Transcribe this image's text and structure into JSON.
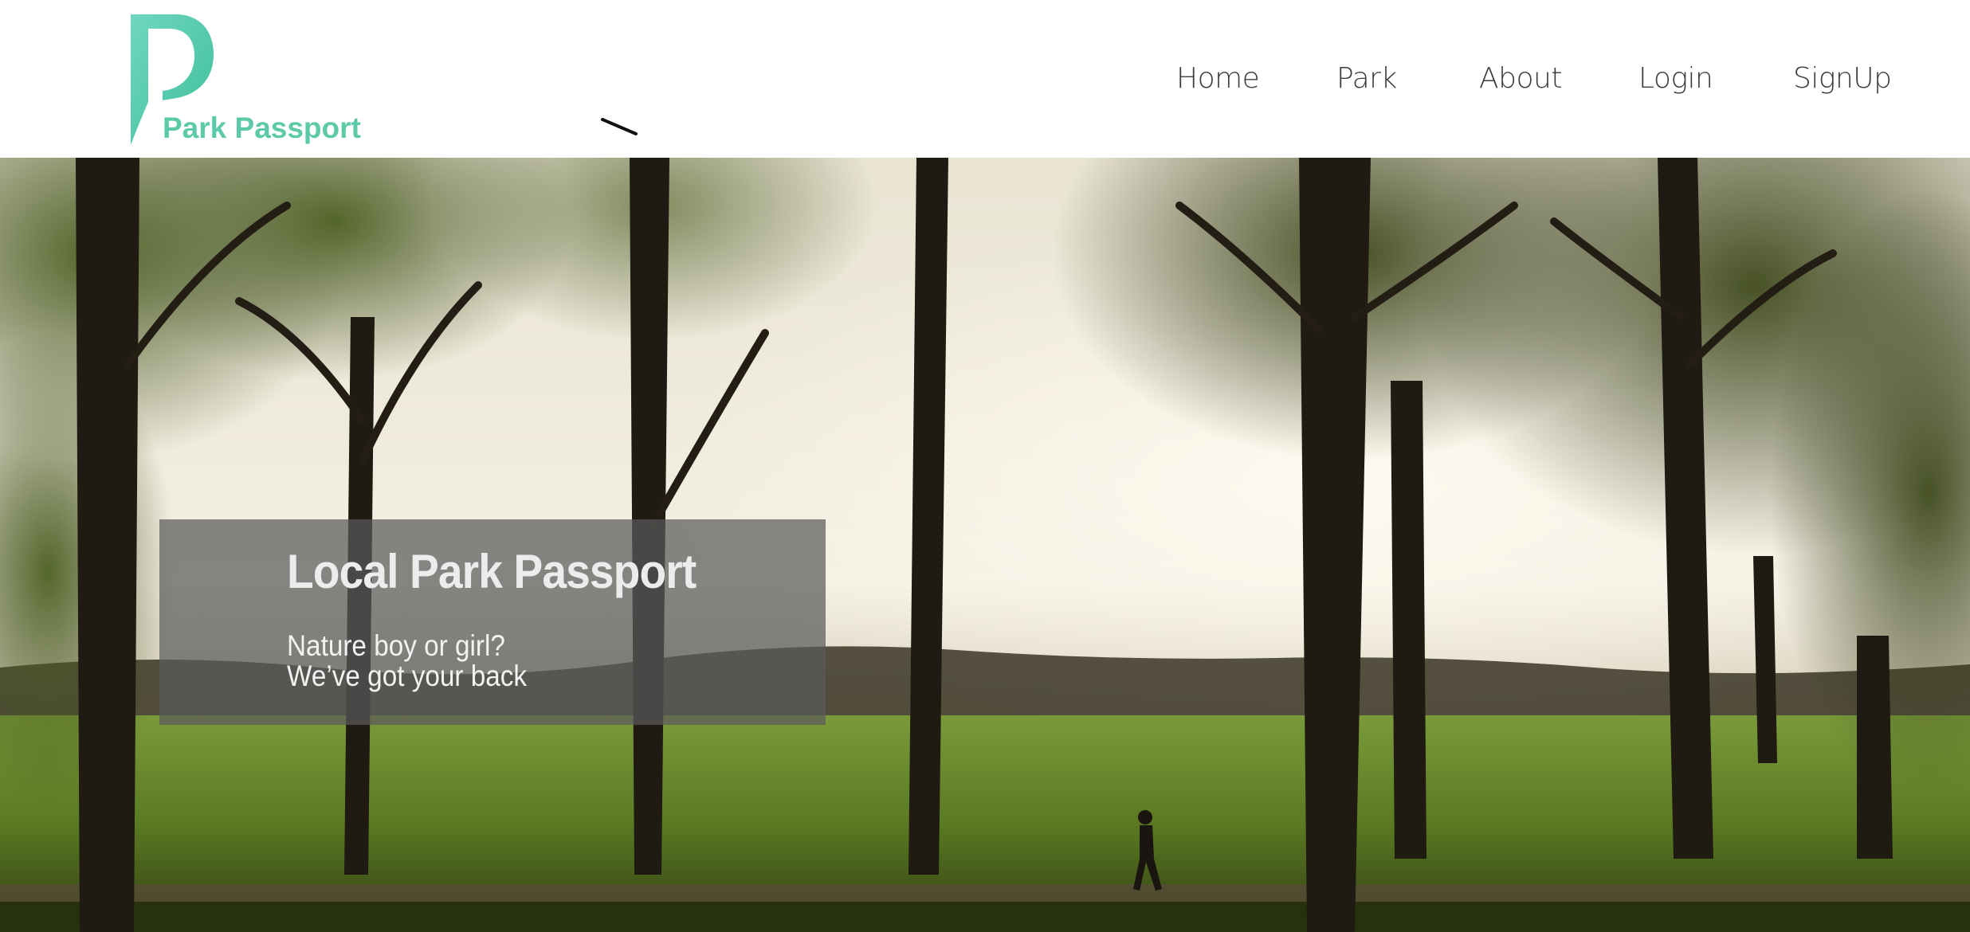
{
  "brand": {
    "name": "Park Passport",
    "logo_icon": "p-logo-icon",
    "color": "#5cc9a9"
  },
  "nav": {
    "items": [
      {
        "label": "Home"
      },
      {
        "label": "Park"
      },
      {
        "label": "About"
      },
      {
        "label": "Login"
      },
      {
        "label": "SignUp"
      }
    ]
  },
  "hero": {
    "background": "park-trees-photo",
    "title": "Local Park Passport",
    "tagline_line1": "Nature boy or girl?",
    "tagline_line2": "We’ve got your back"
  }
}
